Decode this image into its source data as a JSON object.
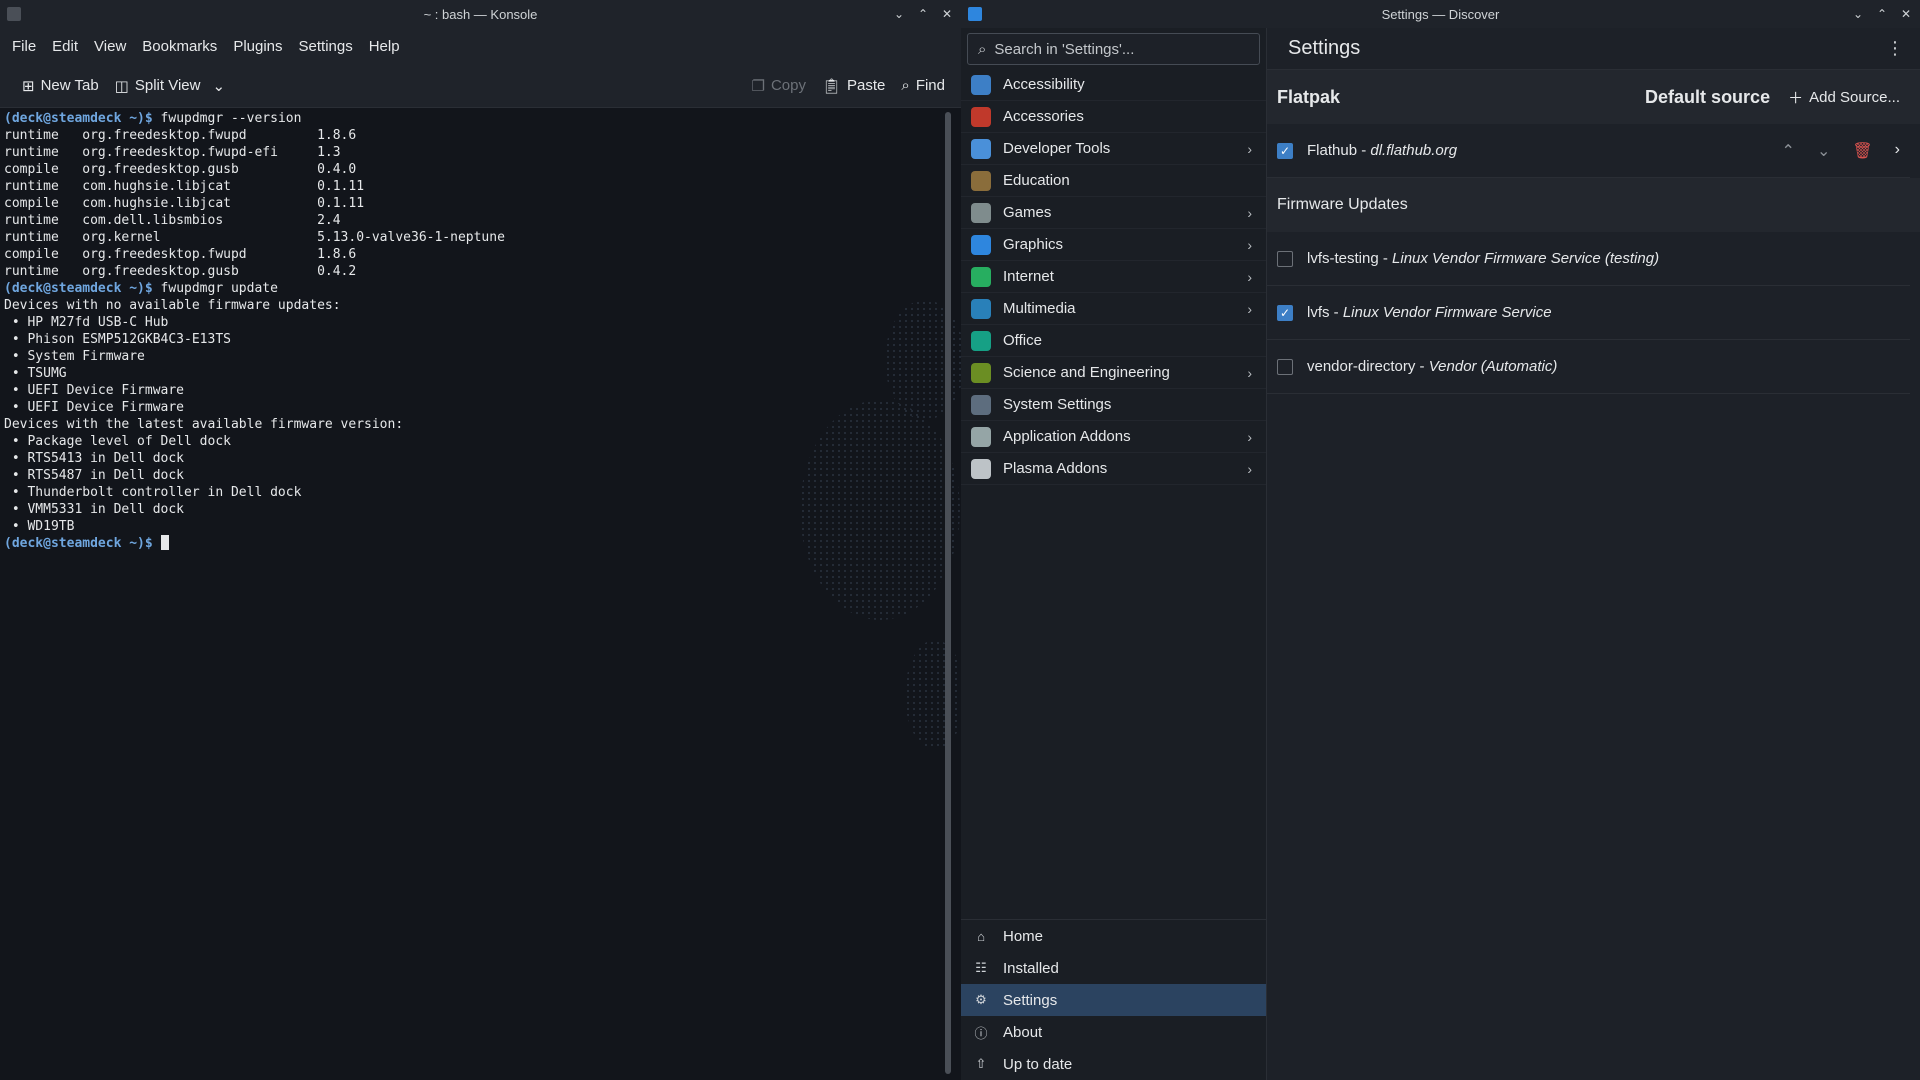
{
  "konsole": {
    "title": "~ : bash — Konsole",
    "menu": [
      "File",
      "Edit",
      "View",
      "Bookmarks",
      "Plugins",
      "Settings",
      "Help"
    ],
    "toolbar": {
      "new_tab": "New Tab",
      "split_view": "Split View",
      "copy": "Copy",
      "paste": "Paste",
      "find": "Find"
    },
    "prompt": "(deck@steamdeck ~)$",
    "lines": [
      {
        "p": true,
        "t": " fwupdmgr --version"
      },
      {
        "t": "runtime   org.freedesktop.fwupd         1.8.6"
      },
      {
        "t": "runtime   org.freedesktop.fwupd-efi     1.3"
      },
      {
        "t": "compile   org.freedesktop.gusb          0.4.0"
      },
      {
        "t": "runtime   com.hughsie.libjcat           0.1.11"
      },
      {
        "t": "compile   com.hughsie.libjcat           0.1.11"
      },
      {
        "t": "runtime   com.dell.libsmbios            2.4"
      },
      {
        "t": "runtime   org.kernel                    5.13.0-valve36-1-neptune"
      },
      {
        "t": "compile   org.freedesktop.fwupd         1.8.6"
      },
      {
        "t": "runtime   org.freedesktop.gusb          0.4.2"
      },
      {
        "p": true,
        "t": " fwupdmgr update"
      },
      {
        "t": "Devices with no available firmware updates:"
      },
      {
        "t": " • HP M27fd USB-C Hub"
      },
      {
        "t": " • Phison ESMP512GKB4C3-E13TS"
      },
      {
        "t": " • System Firmware"
      },
      {
        "t": " • TSUMG"
      },
      {
        "t": " • UEFI Device Firmware"
      },
      {
        "t": " • UEFI Device Firmware"
      },
      {
        "t": "Devices with the latest available firmware version:"
      },
      {
        "t": " • Package level of Dell dock"
      },
      {
        "t": " • RTS5413 in Dell dock"
      },
      {
        "t": " • RTS5487 in Dell dock"
      },
      {
        "t": " • Thunderbolt controller in Dell dock"
      },
      {
        "t": " • VMM5331 in Dell dock"
      },
      {
        "t": " • WD19TB"
      },
      {
        "p": true,
        "t": " ",
        "cursor": true
      }
    ]
  },
  "discover": {
    "title": "Settings — Discover",
    "search_placeholder": "Search in 'Settings'...",
    "categories": [
      {
        "label": "Accessibility",
        "icon": "accessibility-icon",
        "color": "#3d7fc6",
        "chev": false
      },
      {
        "label": "Accessories",
        "icon": "accessories-icon",
        "color": "#c0392b",
        "chev": false
      },
      {
        "label": "Developer Tools",
        "icon": "developer-tools-icon",
        "color": "#4a90d9",
        "chev": true
      },
      {
        "label": "Education",
        "icon": "education-icon",
        "color": "#8a6d3b",
        "chev": false
      },
      {
        "label": "Games",
        "icon": "games-icon",
        "color": "#7f8c8d",
        "chev": true
      },
      {
        "label": "Graphics",
        "icon": "graphics-icon",
        "color": "#2e86de",
        "chev": true
      },
      {
        "label": "Internet",
        "icon": "internet-icon",
        "color": "#27ae60",
        "chev": true
      },
      {
        "label": "Multimedia",
        "icon": "multimedia-icon",
        "color": "#2980b9",
        "chev": true
      },
      {
        "label": "Office",
        "icon": "office-icon",
        "color": "#16a085",
        "chev": false
      },
      {
        "label": "Science and Engineering",
        "icon": "science-icon",
        "color": "#6b8e23",
        "chev": true
      },
      {
        "label": "System Settings",
        "icon": "system-settings-icon",
        "color": "#5d6d7e",
        "chev": false
      },
      {
        "label": "Application Addons",
        "icon": "application-addons-icon",
        "color": "#95a5a6",
        "chev": true
      },
      {
        "label": "Plasma Addons",
        "icon": "plasma-addons-icon",
        "color": "#bdc3c7",
        "chev": true
      }
    ],
    "nav": [
      {
        "label": "Home",
        "icon": "home-icon",
        "glyph": "⌂",
        "active": false
      },
      {
        "label": "Installed",
        "icon": "installed-icon",
        "glyph": "☷",
        "active": false
      },
      {
        "label": "Settings",
        "icon": "settings-icon",
        "glyph": "⚙",
        "active": true
      },
      {
        "label": "About",
        "icon": "about-icon",
        "glyph": "ⓘ",
        "active": false
      },
      {
        "label": "Up to date",
        "icon": "update-icon",
        "glyph": "⇧",
        "active": false
      }
    ],
    "header_title": "Settings",
    "flatpak": {
      "title": "Flatpak",
      "default_source": "Default source",
      "add_source": "Add Source...",
      "sources": [
        {
          "name": "Flathub - ",
          "desc": "dl.flathub.org",
          "checked": true
        }
      ]
    },
    "firmware": {
      "title": "Firmware Updates",
      "sources": [
        {
          "name": "lvfs-testing - ",
          "desc": "Linux Vendor Firmware Service (testing)",
          "checked": false
        },
        {
          "name": "lvfs - ",
          "desc": "Linux Vendor Firmware Service",
          "checked": true
        },
        {
          "name": "vendor-directory - ",
          "desc": "Vendor (Automatic)",
          "checked": false
        }
      ]
    }
  }
}
